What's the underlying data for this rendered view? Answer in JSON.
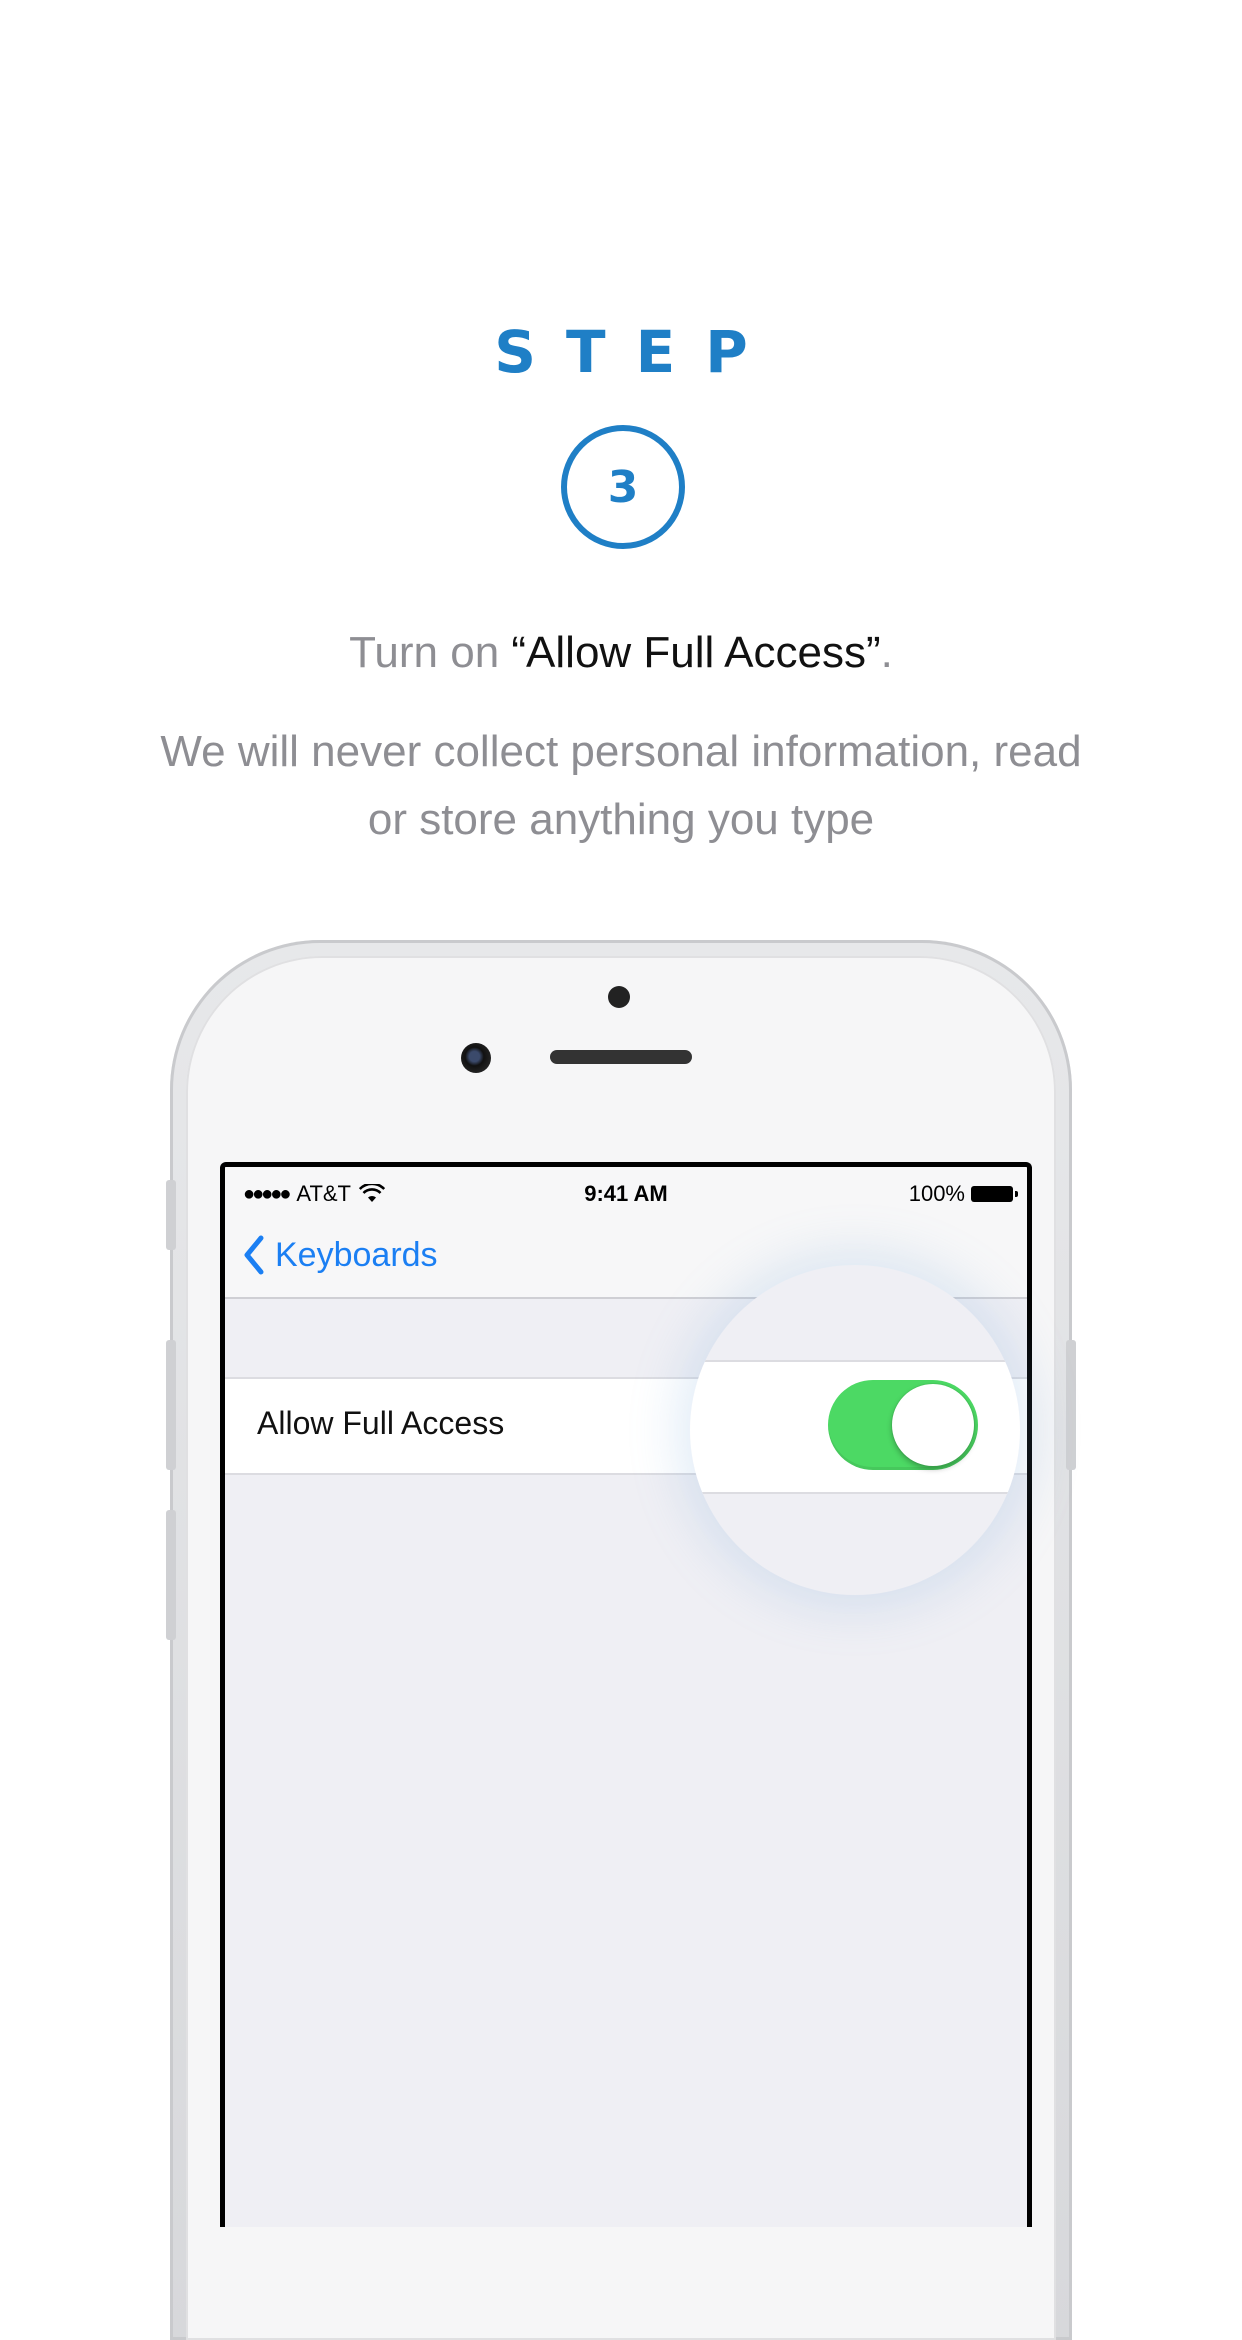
{
  "header": {
    "step_label": "STEP",
    "step_number": "3"
  },
  "instruction": {
    "prefix": "Turn on ",
    "emphasis": "“Allow Full Access”",
    "suffix": ".",
    "subtext": "We will never collect personal information, read or store anything you type"
  },
  "statusbar": {
    "signal_dots": "●●●●●",
    "carrier": "AT&T",
    "time": "9:41 AM",
    "battery": "100%"
  },
  "navbar": {
    "back_label": "Keyboards"
  },
  "settings": {
    "row_label": "Allow Full Access",
    "toggle_on": true
  },
  "colors": {
    "accent": "#1f7fc6",
    "ios_blue": "#1b7ff3",
    "toggle_green": "#4cd964"
  }
}
